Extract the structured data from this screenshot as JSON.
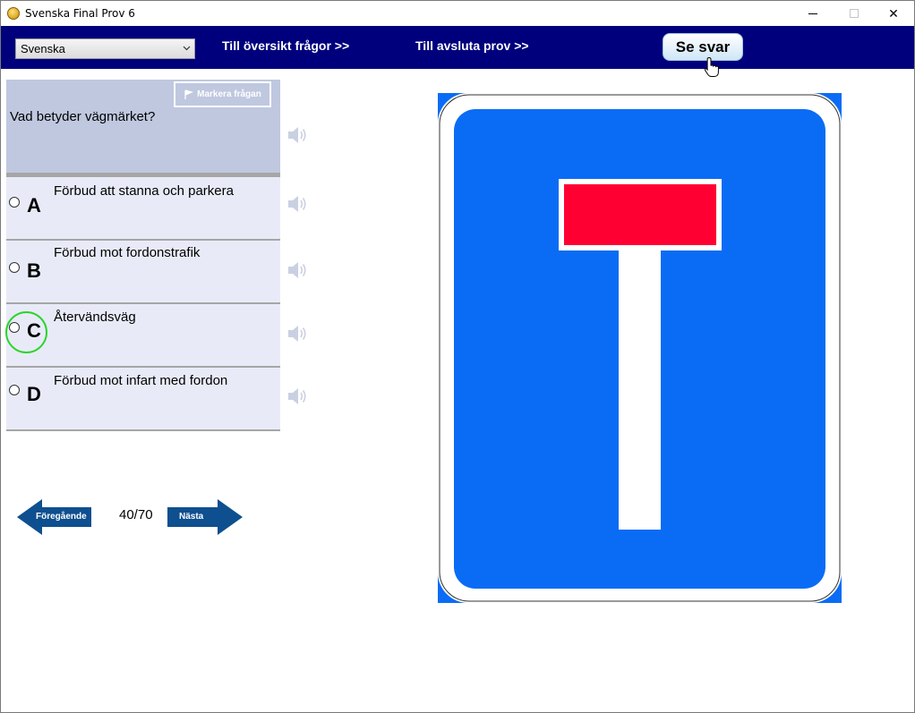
{
  "window": {
    "title": "Svenska Final Prov 6",
    "close_glyph": "✕"
  },
  "toolbar": {
    "language_selected": "Svenska",
    "link_overview": "Till översikt frågor >>",
    "link_finish": "Till avsluta prov  >>",
    "show_answer": "Se svar"
  },
  "question": {
    "mark_label": "Markera frågan",
    "text": "Vad betyder vägmärket?"
  },
  "answers": [
    {
      "letter": "A",
      "text": "Förbud att stanna och parkera"
    },
    {
      "letter": "B",
      "text": "Förbud mot fordonstrafik"
    },
    {
      "letter": "C",
      "text": "Återvändsväg"
    },
    {
      "letter": "D",
      "text": "Förbud mot infart med fordon"
    }
  ],
  "pager": {
    "previous_label": "Föregående",
    "next_label": "Nästa",
    "position": "40/70"
  },
  "sign": {
    "background_color": "#0a6cf5",
    "border_color": "#ffffff",
    "bar_color": "#ff0033",
    "icon": "dead-end-road-sign"
  },
  "colors": {
    "toolbar": "#00007d",
    "question_bg": "#bfc8df",
    "answer_bg": "#e8ebf7",
    "highlight": "#2bd42b"
  }
}
